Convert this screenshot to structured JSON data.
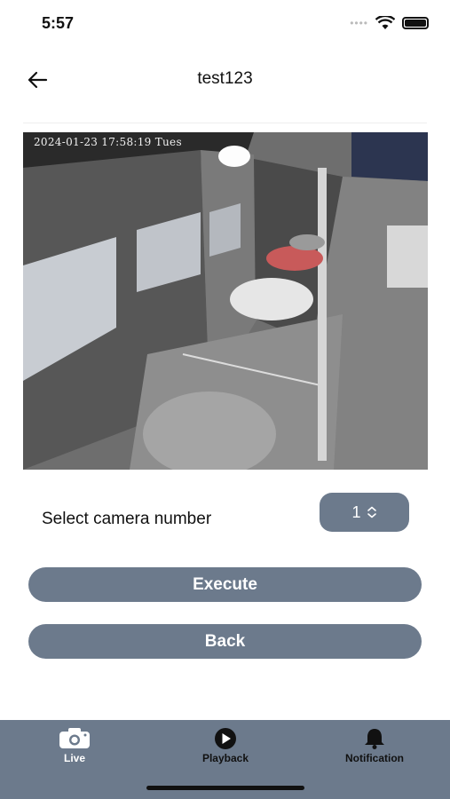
{
  "status_bar": {
    "time": "5:57"
  },
  "header": {
    "title": "test123",
    "back_icon": "arrow-left-icon"
  },
  "camera_feed": {
    "timestamp": "2024-01-23 17:58:19 Tues"
  },
  "camera_select": {
    "label": "Select camera number",
    "value": "1",
    "stepper_icon": "up-down-chevron-icon"
  },
  "actions": {
    "execute_label": "Execute",
    "back_label": "Back"
  },
  "tab_bar": {
    "items": [
      {
        "label": "Live",
        "icon": "camera-icon",
        "active": true
      },
      {
        "label": "Playback",
        "icon": "play-icon",
        "active": false
      },
      {
        "label": "Notification",
        "icon": "bell-icon",
        "active": false
      }
    ]
  },
  "colors": {
    "accent": "#6c7a8c",
    "active_tab_text": "#ffffff",
    "inactive_tab_text": "#111111"
  }
}
